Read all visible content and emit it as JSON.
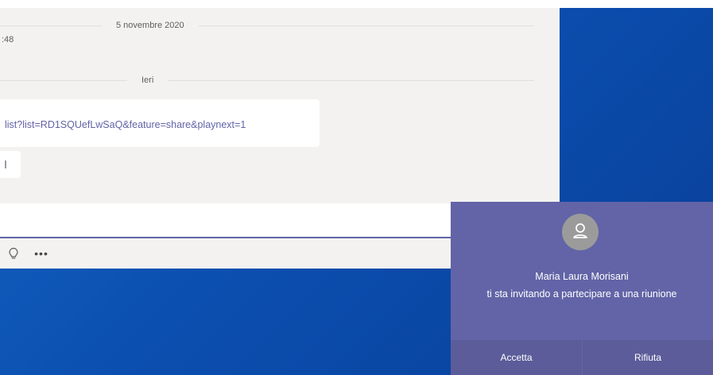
{
  "chat": {
    "dividers": [
      "5 novembre 2020",
      "Ieri"
    ],
    "timestamp": ":48",
    "message_link": "list?list=RD1SQUefLwSaQ&feature=share&playnext=1"
  },
  "toolbar": {
    "icons": [
      "lightbulb-icon",
      "more-options-icon"
    ],
    "more_label": "•••"
  },
  "call_toast": {
    "caller_name": "Maria Laura Morisani",
    "message": "ti sta invitando a partecipare a una riunione",
    "accept_label": "Accetta",
    "reject_label": "Rifiuta"
  },
  "colors": {
    "accent": "#6264a7",
    "toast_bg": "#6264a7",
    "desktop_blue": "#0b4fb0",
    "chat_bg": "#f3f2f1"
  }
}
